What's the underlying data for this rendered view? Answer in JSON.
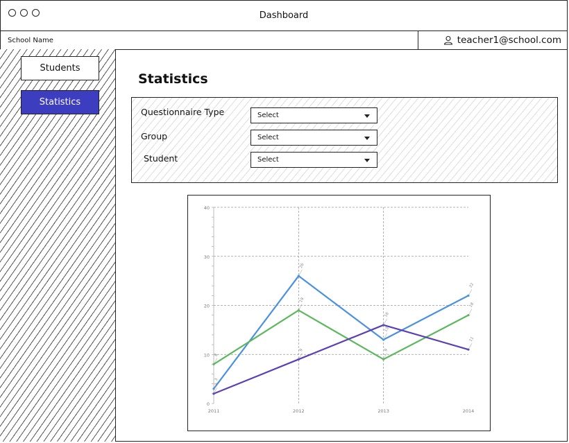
{
  "window": {
    "title": "Dashboard"
  },
  "header": {
    "school_name": "School Name",
    "user_email": "teacher1@school.com"
  },
  "sidebar": {
    "items": [
      {
        "label": "Students"
      },
      {
        "label": "Statistics"
      }
    ]
  },
  "page": {
    "title": "Statistics"
  },
  "filters": [
    {
      "label": "Questionnaire Type",
      "value": "Select"
    },
    {
      "label": "Group",
      "value": "Select"
    },
    {
      "label": "Student",
      "value": "Select"
    }
  ],
  "colors": {
    "active_nav": "#3d3dc0",
    "series1": "#4a90e2",
    "series2": "#5cb85c",
    "series3": "#5b3fb5"
  },
  "chart_data": {
    "type": "line",
    "x": [
      "2011",
      "2012",
      "2013",
      "2014"
    ],
    "ylim": [
      0,
      40
    ],
    "yticks": [
      0,
      10,
      20,
      30,
      40
    ],
    "grid": true,
    "series": [
      {
        "values": [
          3,
          26,
          13,
          22
        ],
        "labels": [
          "3",
          "26",
          "13",
          "22"
        ],
        "color": "#4a90e2"
      },
      {
        "values": [
          8,
          19,
          9,
          18
        ],
        "labels": [
          "8",
          "19",
          "9",
          "18"
        ],
        "color": "#5cb85c"
      },
      {
        "values": [
          2,
          9,
          16,
          11
        ],
        "labels": [
          "2",
          "9",
          "16",
          "11"
        ],
        "color": "#5b3fb5"
      }
    ]
  }
}
